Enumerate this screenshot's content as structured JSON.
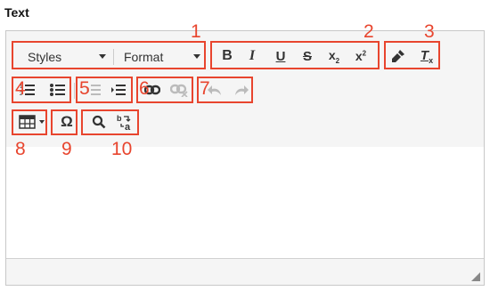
{
  "field": {
    "label": "Text"
  },
  "toolbar": {
    "styles_label": "Styles",
    "format_label": "Format",
    "callout_color": "#e8452e",
    "icons": [
      "bold-icon",
      "italic-icon",
      "underline-icon",
      "strikethrough-icon",
      "subscript-icon",
      "superscript-icon",
      "brush-icon",
      "clear-format-icon",
      "numbered-list-icon",
      "bulleted-list-icon",
      "outdent-icon",
      "indent-icon",
      "link-icon",
      "unlink-icon",
      "undo-icon",
      "redo-icon",
      "table-icon",
      "special-char-icon",
      "find-icon",
      "replace-icon"
    ]
  },
  "callouts": [
    "1",
    "2",
    "3",
    "4",
    "5",
    "6",
    "7",
    "8",
    "9",
    "10"
  ]
}
